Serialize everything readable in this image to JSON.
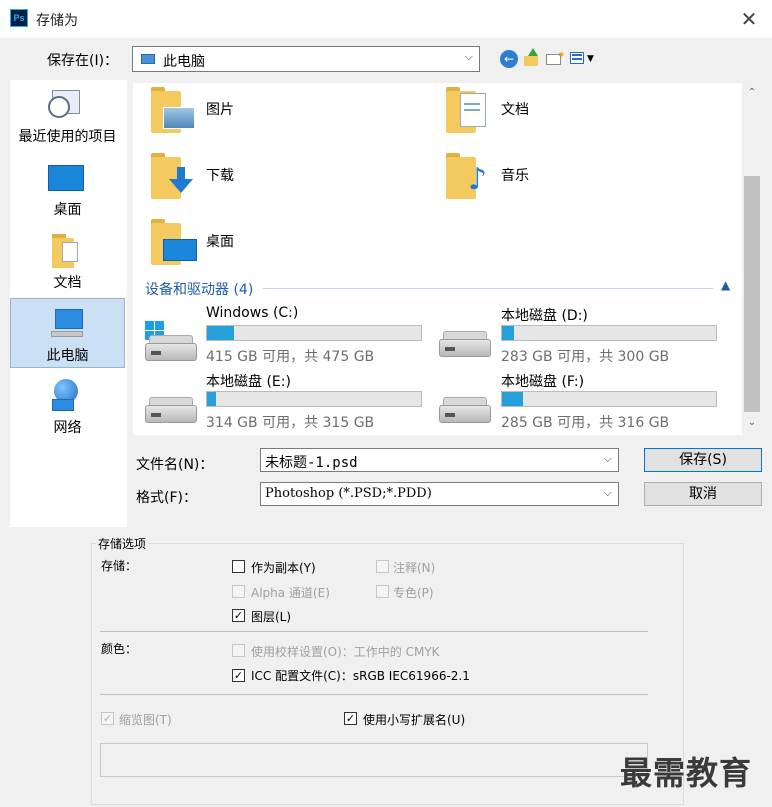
{
  "window": {
    "title": "存储为",
    "app_badge": "Ps",
    "close_glyph": "✕"
  },
  "save_in": {
    "label": "保存在(I)：",
    "value": "此电脑"
  },
  "places": [
    {
      "label": "最近使用的项目"
    },
    {
      "label": "桌面"
    },
    {
      "label": "文档"
    },
    {
      "label": "此电脑",
      "selected": true
    },
    {
      "label": "网络"
    }
  ],
  "folders": [
    {
      "label": "图片",
      "icon": "pictures-folder-icon"
    },
    {
      "label": "文档",
      "icon": "documents-folder-icon"
    },
    {
      "label": "下载",
      "icon": "downloads-folder-icon"
    },
    {
      "label": "音乐",
      "icon": "music-folder-icon"
    },
    {
      "label": "桌面",
      "icon": "desktop-folder-icon"
    }
  ],
  "devices_section": {
    "label": "设备和驱动器 (4)"
  },
  "drives": [
    {
      "name": "Windows (C:)",
      "free_text": "415 GB 可用，共 475 GB",
      "used_fraction": 0.126
    },
    {
      "name": "本地磁盘 (D:)",
      "free_text": "283 GB 可用，共 300 GB",
      "used_fraction": 0.057
    },
    {
      "name": "本地磁盘 (E:)",
      "free_text": "314 GB 可用，共 315 GB",
      "used_fraction": 0.003
    },
    {
      "name": "本地磁盘 (F:)",
      "free_text": "285 GB 可用，共 316 GB",
      "used_fraction": 0.098
    }
  ],
  "filename": {
    "label": "文件名(N)：",
    "value": "未标题-1.psd"
  },
  "format": {
    "label": "格式(F)：",
    "value": "Photoshop (*.PSD;*.PDD)"
  },
  "buttons": {
    "save": "保存(S)",
    "cancel": "取消"
  },
  "options": {
    "title": "存储选项",
    "storage_label": "存储：",
    "as_copy": "作为副本(Y)",
    "notes": "注释(N)",
    "alpha": "Alpha 通道(E)",
    "spot": "专色(P)",
    "layers": "图层(L)",
    "color_label": "颜色：",
    "proof_setup": "使用校样设置(O)：工作中的 CMYK",
    "icc": "ICC 配置文件(C)：sRGB IEC61966-2.1",
    "thumbnail": "缩览图(T)",
    "lowercase_ext": "使用小写扩展名(U)"
  },
  "watermark": "最需教育",
  "colors": {
    "accent": "#26a0da",
    "section_blue": "#1e5ca8",
    "selected_bg": "#cce0f5"
  }
}
